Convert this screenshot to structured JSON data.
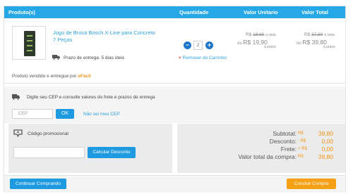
{
  "table_header": {
    "product": "Produto(s)",
    "quantity": "Quantidade",
    "unit_value": "Valor Unitario",
    "total_value": "Valor Total"
  },
  "item": {
    "name": "Jogo de Broca Bosch X-Line para Concreto 7 Peças",
    "shipping_label": "Prazo de entrega: 5 dias úteis",
    "quantity": "2",
    "remove_label": "Remover do Carrinho",
    "unit": {
      "old_currency": "R$",
      "old_price": "18,90",
      "old_suffix": "à vista",
      "currency": "R$",
      "price": "19,90",
      "suffix": "à prazo"
    },
    "total": {
      "old_currency": "R$",
      "old_price": "37,80",
      "old_suffix": "à vista",
      "currency": "R$",
      "price": "39,80",
      "suffix": "à prazo"
    }
  },
  "seller": {
    "prefix": "Produto vendido e entregue por",
    "name": "eFácil"
  },
  "cep": {
    "label": "Digite seu CEP e consulte valores do frete e prazos de entrega",
    "placeholder": "CEP",
    "ok_label": "OK",
    "unknown_link": "Não sei meu CEP"
  },
  "promo": {
    "label": "Código promocional",
    "button_label": "Calcular Desconto"
  },
  "totals": [
    {
      "label": "Subtotal:",
      "currency": "R$",
      "value": "39,80"
    },
    {
      "label": "Desconto:",
      "currency": "- R$",
      "value": "0,00"
    },
    {
      "label": "Frete:",
      "currency": "+ R$",
      "value": "0,00"
    },
    {
      "label": "Valor total da compra:",
      "currency": "R$",
      "value": "39,80"
    }
  ],
  "footer": {
    "continue_label": "Continuar Comprando",
    "checkout_label": "Concluir Compra"
  },
  "colors": {
    "header": "#27a8e6",
    "link": "#2aa0dc",
    "accent": "#f19417",
    "button": "#1e9ae0",
    "checkout": "#f5a015"
  },
  "icons": {
    "truck": "truck-icon",
    "pin": "location-truck-icon",
    "tag": "discount-tag-icon",
    "remove": "close-icon"
  }
}
